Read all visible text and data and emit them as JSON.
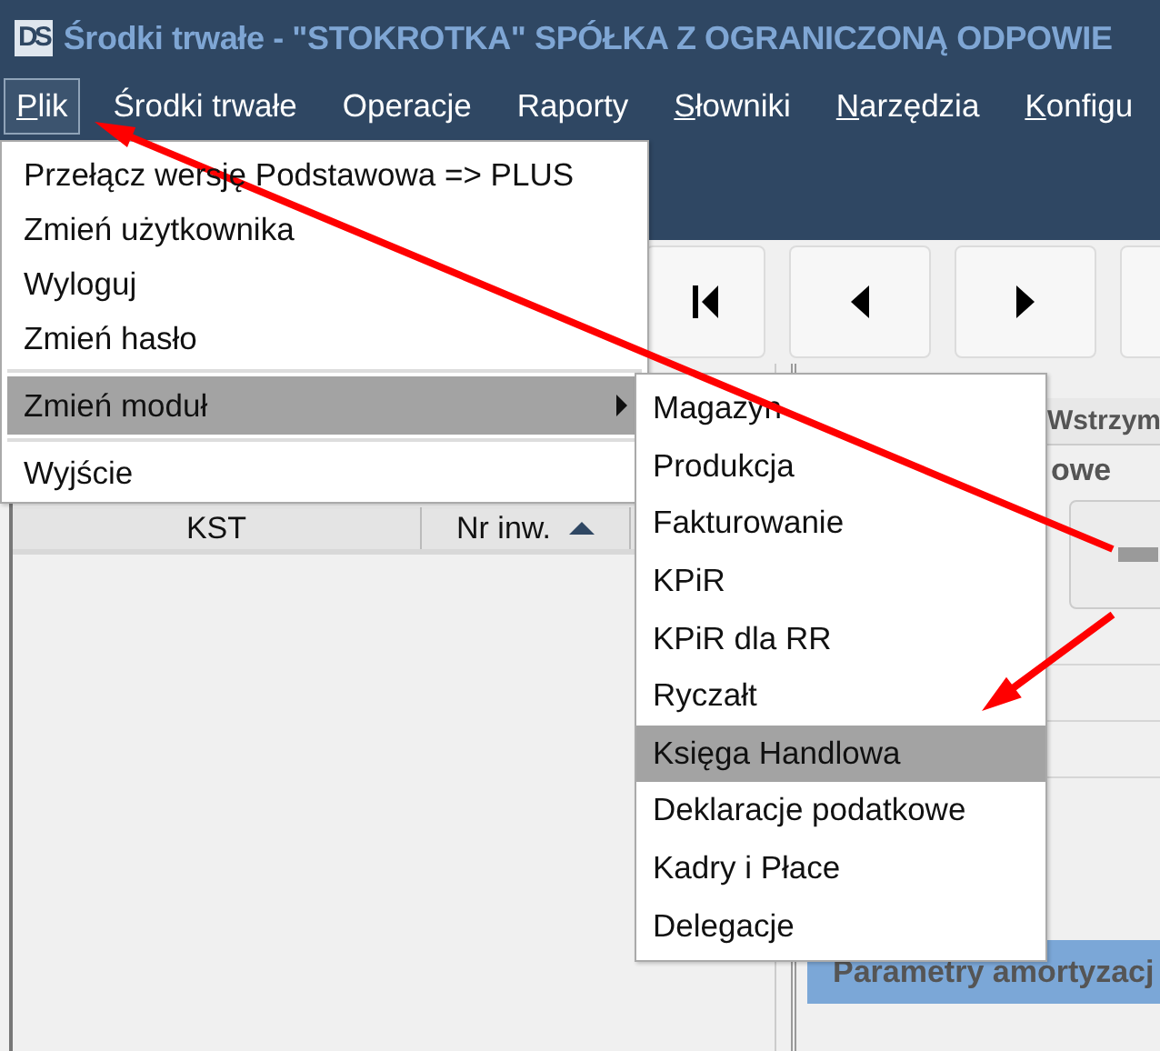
{
  "window": {
    "logo": "DS",
    "title": "Środki trwałe - \"STOKROTKA\" SPÓŁKA Z OGRANICZONĄ ODPOWIE"
  },
  "menubar": [
    {
      "label": "Plik",
      "underline_first": true,
      "selected": true
    },
    {
      "label": "Środki trwałe",
      "underline_first": false,
      "selected": false
    },
    {
      "label": "Operacje",
      "underline_first": false,
      "selected": false
    },
    {
      "label": "Raporty",
      "underline_first": false,
      "selected": false
    },
    {
      "label": "Słowniki",
      "underline_first": true,
      "selected": false
    },
    {
      "label": "Narzędzia",
      "underline_first": true,
      "selected": false
    },
    {
      "label": "Konfigu",
      "underline_first": true,
      "selected": false
    }
  ],
  "file_menu": [
    {
      "kind": "item",
      "label": "Przełącz wersję Podstawowa => PLUS",
      "selected": false,
      "has_submenu": false
    },
    {
      "kind": "item",
      "label": "Zmień użytkownika",
      "selected": false,
      "has_submenu": false
    },
    {
      "kind": "item",
      "label": "Wyloguj",
      "selected": false,
      "has_submenu": false
    },
    {
      "kind": "item",
      "label": "Zmień hasło",
      "selected": false,
      "has_submenu": false
    },
    {
      "kind": "separator"
    },
    {
      "kind": "item",
      "label": "Zmień moduł",
      "selected": true,
      "has_submenu": true
    },
    {
      "kind": "separator"
    },
    {
      "kind": "item",
      "label": "Wyjście",
      "selected": false,
      "has_submenu": false
    }
  ],
  "module_submenu": [
    {
      "label": "Magazyn",
      "selected": false
    },
    {
      "label": "Produkcja",
      "selected": false
    },
    {
      "label": "Fakturowanie",
      "selected": false
    },
    {
      "label": "KPiR",
      "selected": false
    },
    {
      "label": "KPiR dla RR",
      "selected": false
    },
    {
      "label": "Ryczałt",
      "selected": false
    },
    {
      "label": "Księga Handlowa",
      "selected": true
    },
    {
      "label": "Deklaracje podatkowe",
      "selected": false
    },
    {
      "label": "Kadry i Płace",
      "selected": false
    },
    {
      "label": "Delegacje",
      "selected": false
    }
  ],
  "toolbar": [
    {
      "kind": "first"
    },
    {
      "kind": "prev"
    },
    {
      "kind": "next"
    },
    {
      "kind": "blank"
    }
  ],
  "list": {
    "columns": [
      {
        "label": "KST",
        "sorted": false
      },
      {
        "label": "Nr inw.",
        "sorted": true
      }
    ]
  },
  "details": {
    "tab": "Wstrzym",
    "group_label": "owe",
    "section_header": "Parametry amortyzacj"
  }
}
